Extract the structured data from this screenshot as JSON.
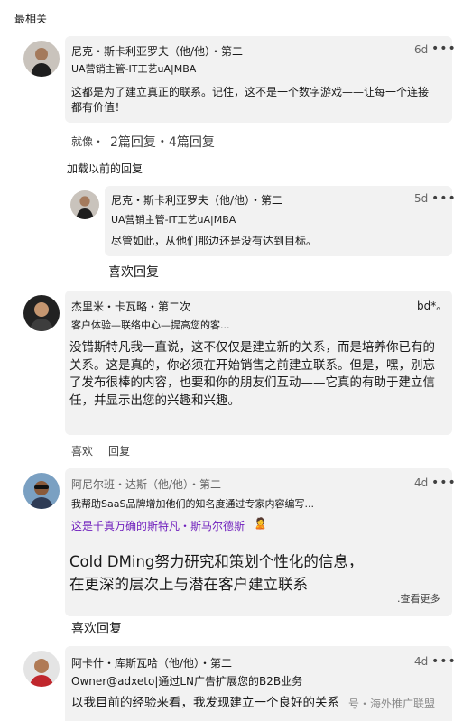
{
  "sort_label": "最相关",
  "comment1": {
    "author": "尼克・斯卡利亚罗夫（他/他）・第二",
    "headline": "UA营销主管-IT工艺uA|MBA",
    "time": "6d",
    "more": "•••",
    "body": "这都是为了建立真正的联系。记住，这不是一个数字游戏——让每一个连接都有价值！",
    "action_like": "就像・",
    "replies": "2篇回复・4篇回复"
  },
  "load_previous": "加载以前的回复",
  "reply1": {
    "author": "尼克・斯卡利亚罗夫（他/他）・第二",
    "headline": "UA营销主管-IT工艺uA|MBA",
    "time": "5d",
    "more": "•••",
    "body": "尽管如此，从他们那边还是没有达到目标。",
    "actions": "喜欢回复"
  },
  "comment2": {
    "author": "杰里米・卡瓦略・第二次",
    "headline": "客户体验—联络中心—提高您的客...",
    "more": "bd*。",
    "body": "没错斯特凡我一直说，这不仅仅是建立新的关系，而是培养你已有的关系。这是真的，你必须在开始销售之前建立联系。但是，嘿，别忘了发布很棒的内容，也要和你的朋友们互动——它真的有助于建立信任，并显示出您的兴趣和兴趣。",
    "like": "喜欢",
    "reply": "回复"
  },
  "comment3": {
    "author": "阿尼尔班・达斯（他/他）・第二",
    "headline": "我帮助SaaS品牌增加他们的知名度通过专家内容编写...",
    "time": "4d",
    "more": "•••",
    "mention": "这是千真万确的斯特凡・斯马尔德斯",
    "mention_emoji": "🙎",
    "body": "Cold DMing努力研究和策划个性化的信息，在更深的层次上与潜在客户建立联系",
    "see_more": ".查看更多",
    "actions": "喜欢回复"
  },
  "comment4": {
    "author": "阿卡什・库斯瓦哈（他/他）・第二",
    "headline": "Owner@adxeto|通过LN广告扩展您的B2B业务",
    "time": "4d",
    "more": "•••",
    "body": "以我目前的经验来看，我发现建立一个良好的关系"
  },
  "watermark": "号・海外推广联盟",
  "colors": {
    "bubble": "#f2f2f2",
    "mention": "#6f1fbd",
    "text": "#191919",
    "muted": "#666666"
  }
}
